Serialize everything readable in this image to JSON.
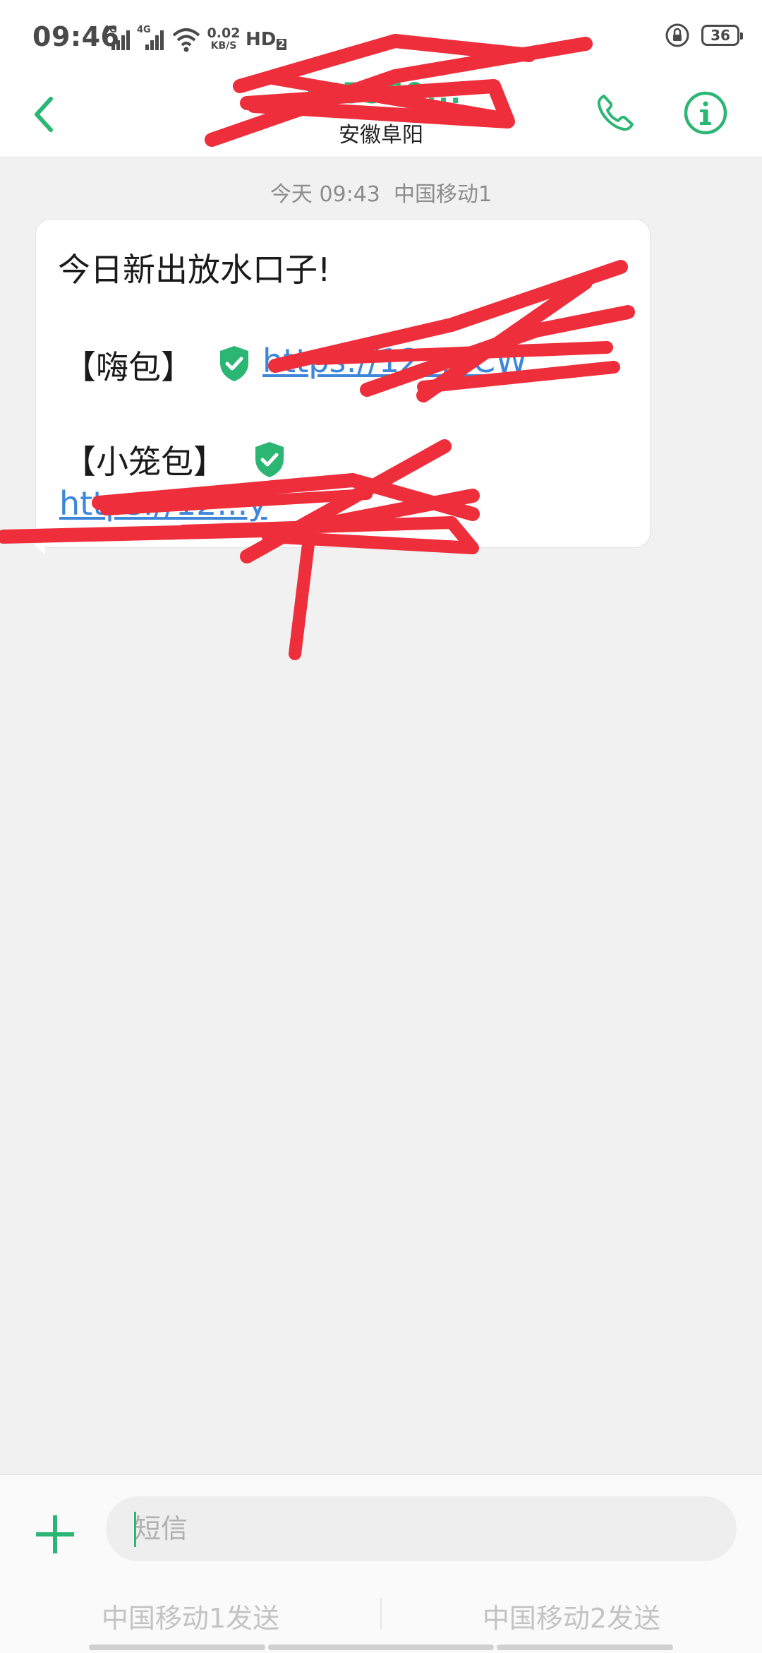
{
  "status_bar": {
    "time": "09:46",
    "network_1": "4G",
    "network_2": "4G",
    "net_speed_value": "0.02",
    "net_speed_unit": "KB/S",
    "hd_label": "HD",
    "hd_sub": "2",
    "battery_level": "36"
  },
  "header": {
    "contact_number": "175560...",
    "contact_location": "安徽阜阳"
  },
  "conversation": {
    "timestamp": "今天 09:43",
    "sim_label": "中国移动1",
    "message": {
      "line_1": "今日新出放水口子!",
      "item_1_label": "【嗨包】",
      "item_1_link": "https://12...BCW",
      "item_2_label": "【小笼包】",
      "item_2_link": "https://12...y"
    }
  },
  "composer": {
    "placeholder": "短信",
    "send_sim1_label": "中国移动1发送",
    "send_sim2_label": "中国移动2发送"
  },
  "colors": {
    "accent": "#2bb673",
    "link": "#3d86d9",
    "redaction": "#ee2e3a"
  }
}
